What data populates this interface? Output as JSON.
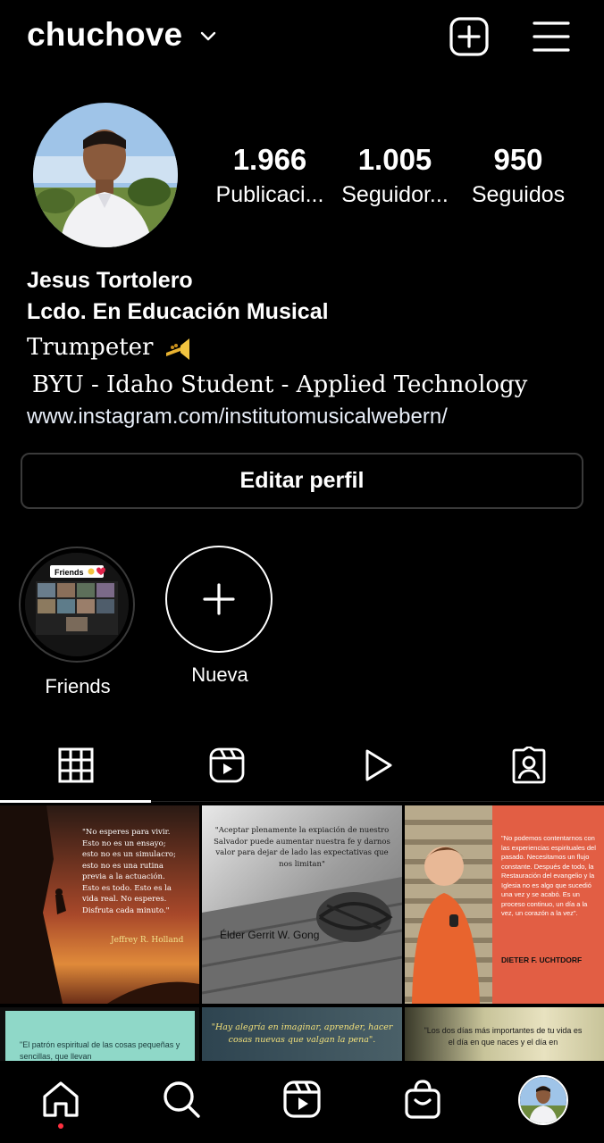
{
  "header": {
    "username": "chuchove",
    "icons": [
      "chevron-down-icon",
      "add-post-icon",
      "menu-icon"
    ]
  },
  "profile": {
    "stats": [
      {
        "value": "1.966",
        "label": "Publicaci..."
      },
      {
        "value": "1.005",
        "label": "Seguidor..."
      },
      {
        "value": "950",
        "label": "Seguidos"
      }
    ],
    "name": "Jesus Tortolero",
    "title": "Lcdo. En Educación Musical",
    "bio_line1": "Trumpeter",
    "bio_line2": "BYU - Idaho Student - Applied Technology",
    "link": "www.instagram.com/institutomusicalwebern/",
    "edit_button": "Editar perfil"
  },
  "highlights": [
    {
      "label": "Friends",
      "cover_text": "Friends"
    },
    {
      "label": "Nueva"
    }
  ],
  "tabs": [
    {
      "icon": "grid-icon",
      "active": true
    },
    {
      "icon": "reels-icon",
      "active": false
    },
    {
      "icon": "play-icon",
      "active": false
    },
    {
      "icon": "tagged-icon",
      "active": false
    }
  ],
  "posts": [
    {
      "quote": "\"No esperes para vivir. Esto no es un ensayo; esto no es un simulacro; esto no es una rutina previa a la actuación. Esto es todo. Esto es la vida real. No esperes. Disfruta cada minuto.\"",
      "author": "Jeffrey R. Holland"
    },
    {
      "quote": "\"Aceptar plenamente la expiación de nuestro Salvador puede aumentar nuestra fe y darnos valor para dejar de lado las expectativas que nos limitan\"",
      "author": "Élder Gerrit W. Gong"
    },
    {
      "quote": "\"No podemos contentarnos con las experiencias espirituales del pasado. Necesitamos un flujo constante. Después de todo, la Restauración del evangelio y la Iglesia no es algo que sucedió una vez y se acabó. Es un proceso continuo, un día a la vez, un corazón a la vez\".",
      "author": "DIETER F. UCHTDORF"
    },
    {
      "quote": "\"El patrón espiritual de las cosas pequeñas y sencillas, que llevan"
    },
    {
      "quote": "\"Hay alegría en imaginar, aprender, hacer cosas nuevas que valgan la pena\"."
    },
    {
      "quote": "\"Los dos días más importantes de tu vida es el día en que naces y el día en"
    }
  ],
  "bottom_nav": [
    "home-icon",
    "search-icon",
    "reels-icon",
    "shop-icon",
    "profile-avatar"
  ],
  "colors": {
    "background": "#000000",
    "text": "#ffffff",
    "border": "#3a3a3a",
    "notification": "#ff3040"
  }
}
